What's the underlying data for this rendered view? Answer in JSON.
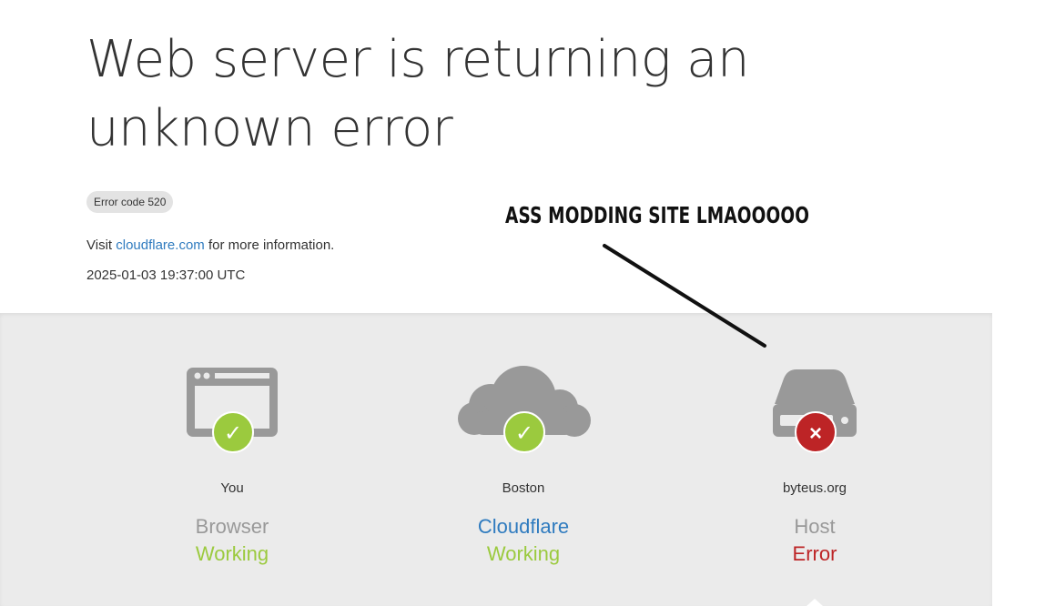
{
  "page": {
    "title": "Web server is returning an unknown error",
    "error_code": "Error code 520",
    "info_prefix": "Visit ",
    "info_link": "cloudflare.com",
    "info_suffix": " for more information.",
    "timestamp": "2025-01-03 19:37:00 UTC"
  },
  "annotation": {
    "text": "ASS MODDING SITE LMAOOOOO"
  },
  "status_columns": [
    {
      "location": "You",
      "kind": "Browser",
      "state": "Working",
      "icon": "browser-window-icon",
      "status_icon": "checkmark-icon",
      "status_glyph": "✓"
    },
    {
      "location": "Boston",
      "kind": "Cloudflare",
      "state": "Working",
      "icon": "cloud-icon",
      "status_icon": "checkmark-icon",
      "status_glyph": "✓"
    },
    {
      "location": "byteus.org",
      "kind": "Host",
      "state": "Error",
      "icon": "server-drive-icon",
      "status_icon": "error-x-icon",
      "status_glyph": "×"
    }
  ],
  "colors": {
    "ok": "#9bca3e",
    "error": "#bd2426",
    "link": "#2f7bbf",
    "icon_gray": "#999999",
    "band_gray": "#ebebeb"
  }
}
